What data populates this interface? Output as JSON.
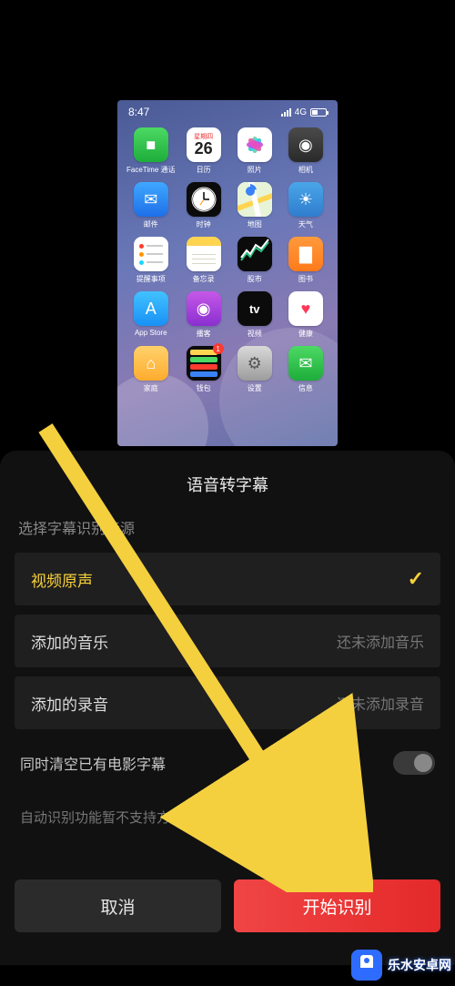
{
  "preview": {
    "status": {
      "time": "8:47",
      "network": "4G"
    },
    "apps": [
      {
        "label": "FaceTime 通话",
        "bg": "linear-gradient(#4cd964,#1ead3a)",
        "glyph": "■",
        "glyphColor": "#fff"
      },
      {
        "label": "日历",
        "bg": "#fff",
        "calendar": {
          "day": "星期四",
          "num": "26"
        }
      },
      {
        "label": "照片",
        "bg": "#fff",
        "flower": true
      },
      {
        "label": "相机",
        "bg": "linear-gradient(#4a4a4a,#2a2a2a)",
        "glyph": "◉"
      },
      {
        "label": "邮件",
        "bg": "linear-gradient(#3fa8ff,#1e6fe8)",
        "glyph": "✉"
      },
      {
        "label": "时钟",
        "bg": "#0b0b0b",
        "clock": true
      },
      {
        "label": "地图",
        "bg": "#fff",
        "maps": true
      },
      {
        "label": "天气",
        "bg": "linear-gradient(#4aa6e8,#2f7dce)",
        "glyph": "☀"
      },
      {
        "label": "提醒事项",
        "bg": "#fff",
        "reminders": true
      },
      {
        "label": "备忘录",
        "bg": "#fff",
        "notes": true
      },
      {
        "label": "股市",
        "bg": "#0b0b0b",
        "stocks": true
      },
      {
        "label": "图书",
        "bg": "linear-gradient(#ff9a3d,#ff7a1a)",
        "glyph": "▇"
      },
      {
        "label": "App Store",
        "bg": "linear-gradient(#42c2ff,#1891f5)",
        "glyph": "A"
      },
      {
        "label": "播客",
        "bg": "linear-gradient(#c658e8,#8a2fd0)",
        "glyph": "◉"
      },
      {
        "label": "视频",
        "bg": "#0b0b0b",
        "glyph": "tv",
        "glyphSize": "11px"
      },
      {
        "label": "健康",
        "bg": "#fff",
        "glyph": "♥",
        "glyphColor": "#ff3756"
      },
      {
        "label": "家庭",
        "bg": "linear-gradient(#ffd26b,#ffab2e)",
        "glyph": "⌂"
      },
      {
        "label": "钱包",
        "bg": "#0b0b0b",
        "wallet": true,
        "badge": "1"
      },
      {
        "label": "设置",
        "bg": "linear-gradient(#d9d9d9,#9c9c9c)",
        "glyph": "⚙",
        "glyphColor": "#555"
      },
      {
        "label": "信息",
        "bg": "linear-gradient(#4cd964,#1ead3a)",
        "glyph": "✉"
      }
    ]
  },
  "panel": {
    "title": "语音转字幕",
    "section_label": "选择字幕识别音源",
    "options": [
      {
        "label": "视频原声",
        "selected": true
      },
      {
        "label": "添加的音乐",
        "status": "还未添加音乐"
      },
      {
        "label": "添加的录音",
        "status": "还未添加录音"
      }
    ],
    "toggle": {
      "label": "同时清空已有电影字幕",
      "on": false
    },
    "hint": "自动识别功能暂不支持方言哦",
    "buttons": {
      "cancel": "取消",
      "start": "开始识别"
    }
  },
  "watermark": {
    "text": "乐水安卓网"
  }
}
